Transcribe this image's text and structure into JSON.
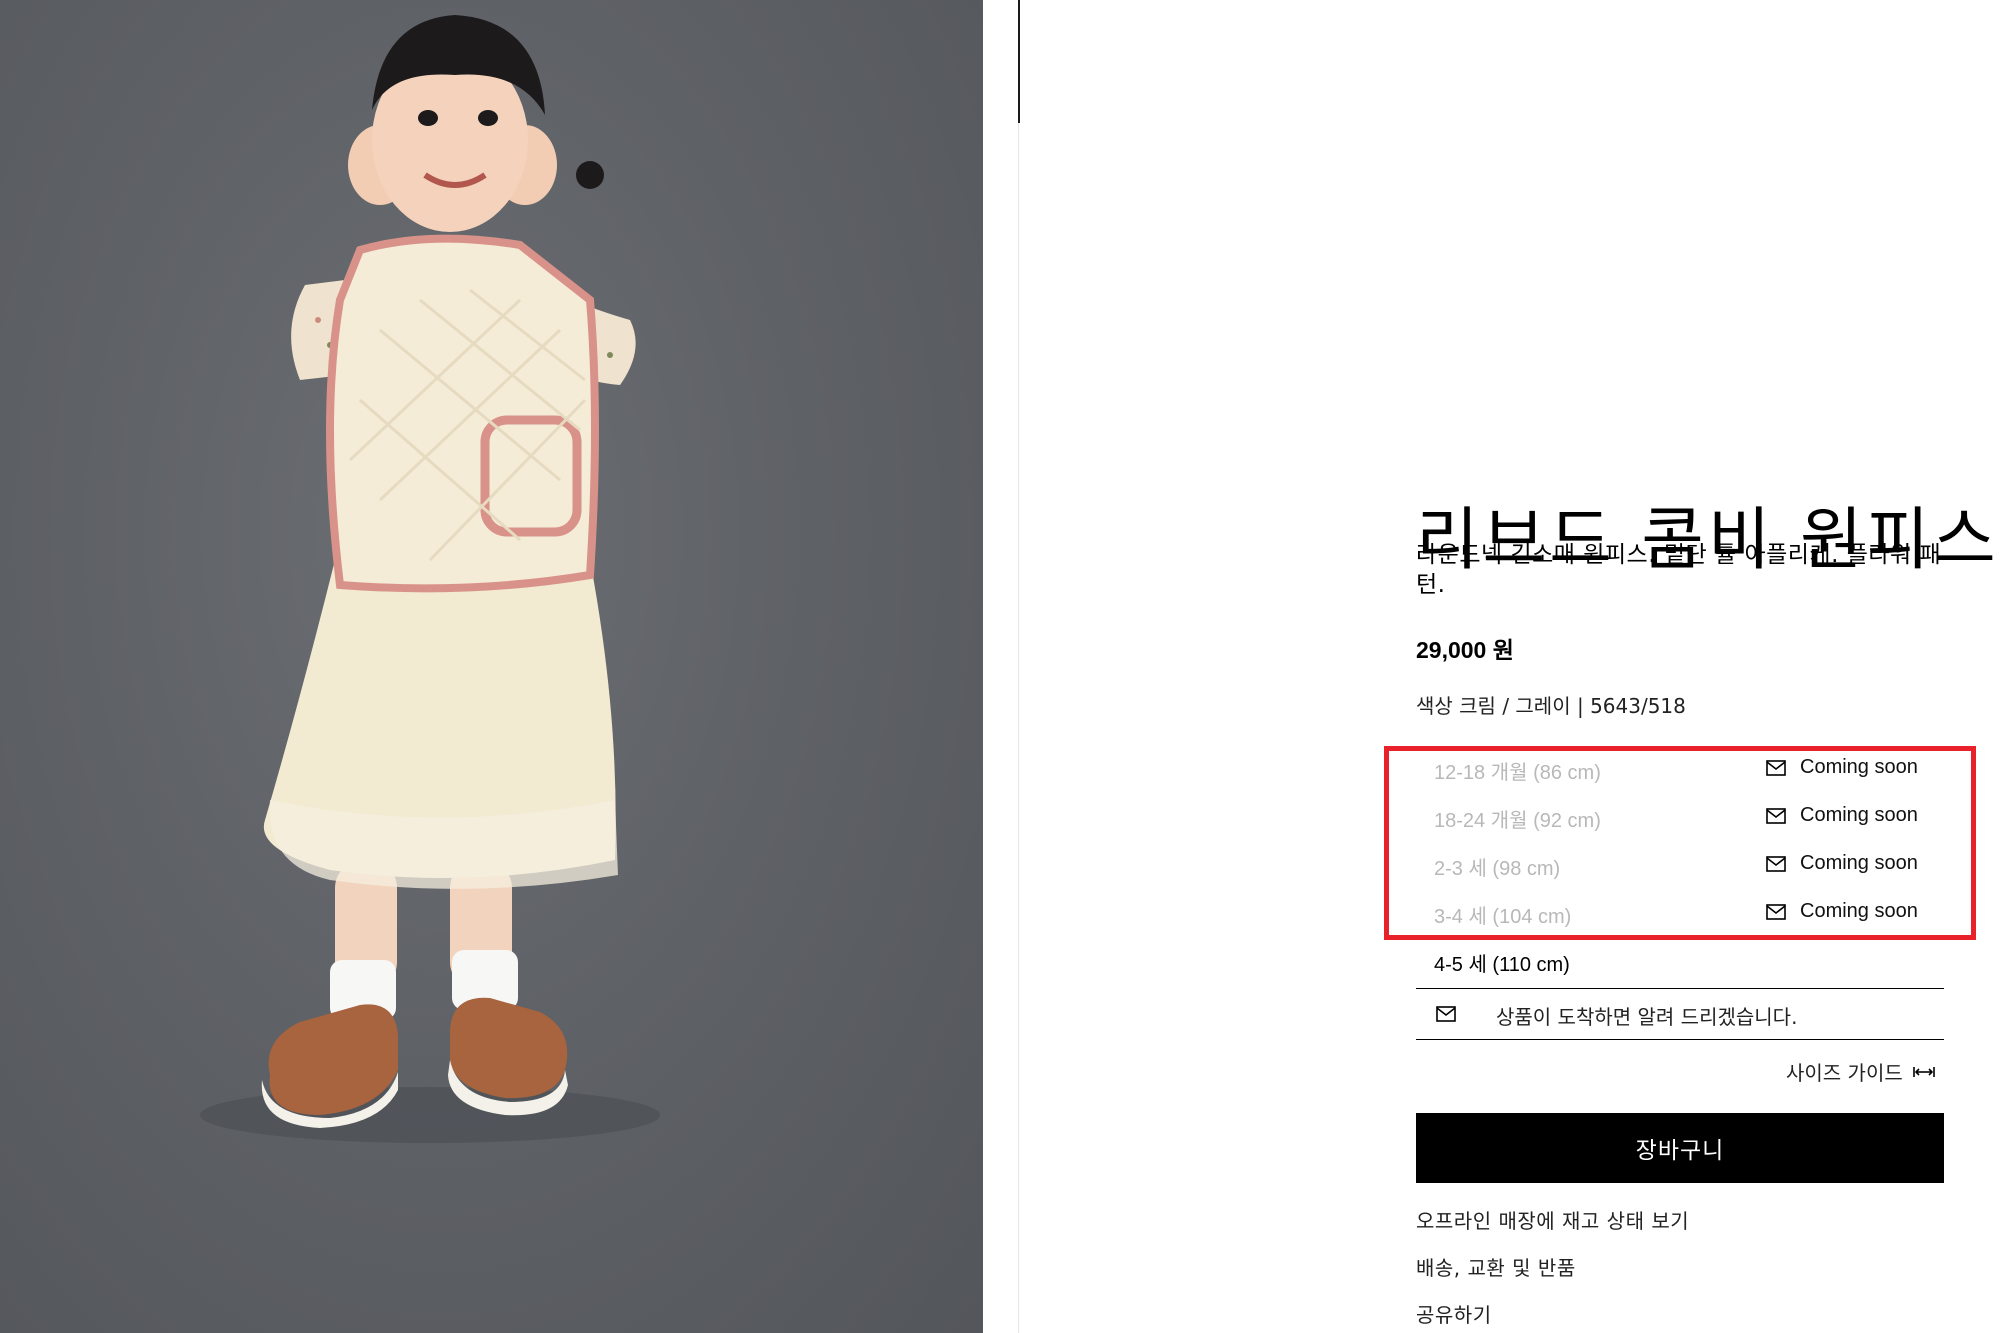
{
  "product": {
    "title": "리브드 콤비 원피스",
    "description": "라운드넥 긴소매 원피스. 밑단 튤 아플리케. 플라워 패턴.",
    "price": "29,000 원",
    "color_line": "색상 크림 / 그레이 | 5643/518"
  },
  "sizes": [
    {
      "label": "12-18 개월 (86 cm)",
      "status": "Coming soon",
      "available": false
    },
    {
      "label": "18-24 개월 (92 cm)",
      "status": "Coming soon",
      "available": false
    },
    {
      "label": "2-3 세 (98 cm)",
      "status": "Coming soon",
      "available": false
    },
    {
      "label": "3-4 세 (104 cm)",
      "status": "Coming soon",
      "available": false
    },
    {
      "label": "4-5 세 (110 cm)",
      "status": "",
      "available": true
    }
  ],
  "notify": {
    "text": "상품이 도착하면 알려 드리겠습니다.",
    "icon": "mail-icon"
  },
  "size_guide": {
    "label": "사이즈 가이드",
    "icon": "ruler-icon"
  },
  "cart_button": {
    "label": "장바구니"
  },
  "links": [
    {
      "label": "오프라인 매장에 재고 상태 보기"
    },
    {
      "label": "배송, 교환 및 반품"
    },
    {
      "label": "공유하기"
    }
  ],
  "colors": {
    "highlight": "#e8212b",
    "button_bg": "#000000",
    "disabled_text": "#b8b8b8"
  }
}
